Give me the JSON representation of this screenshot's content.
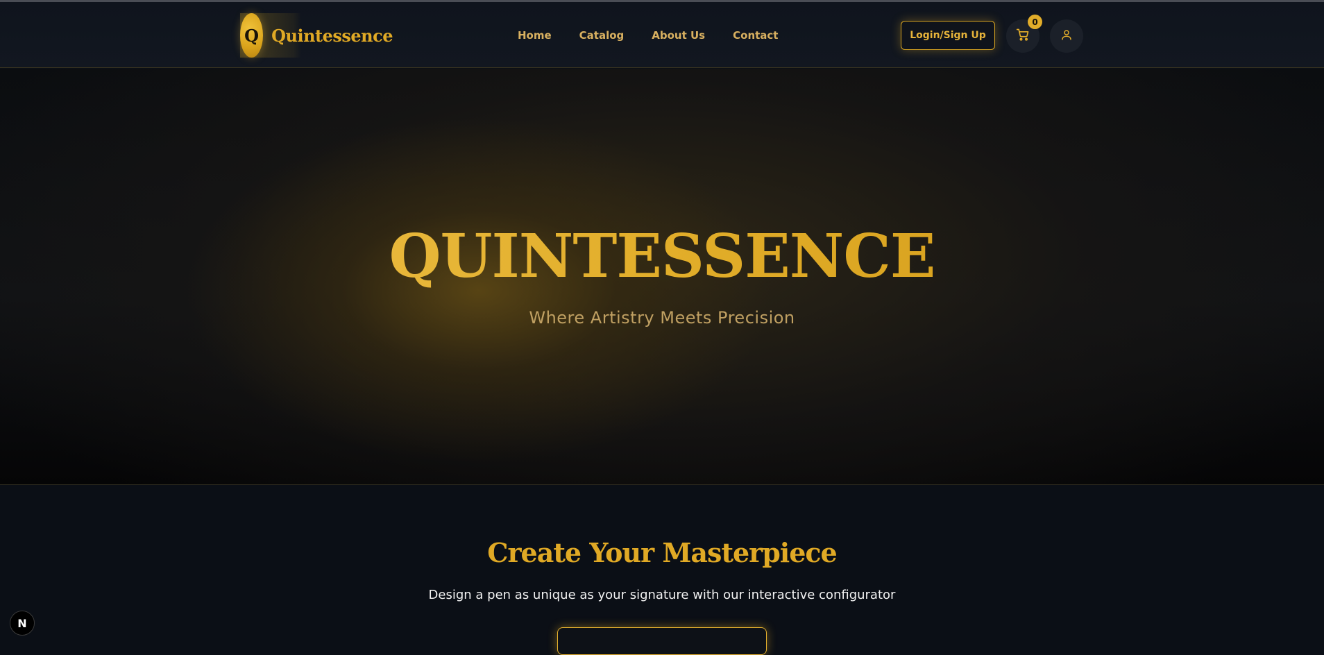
{
  "navbar": {
    "brand": {
      "badge_letter": "Q",
      "name": "Quintessence"
    },
    "links": [
      {
        "label": "Home"
      },
      {
        "label": "Catalog"
      },
      {
        "label": "About Us"
      },
      {
        "label": "Contact"
      }
    ],
    "login_label": "Login/Sign Up",
    "cart": {
      "icon": "cart-icon",
      "count": "0"
    },
    "user_icon": "user-icon"
  },
  "hero": {
    "title": "QUINTESSENCE",
    "subtitle": "Where Artistry Meets Precision"
  },
  "masterpiece": {
    "title": "Create Your Masterpiece",
    "description": "Design a pen as unique as your signature with our interactive configurator"
  },
  "floating_badge": {
    "label": "N"
  },
  "colors": {
    "accent_gold": "#e0a925",
    "background": "#0b0f16",
    "nav_text": "#d8b060"
  }
}
